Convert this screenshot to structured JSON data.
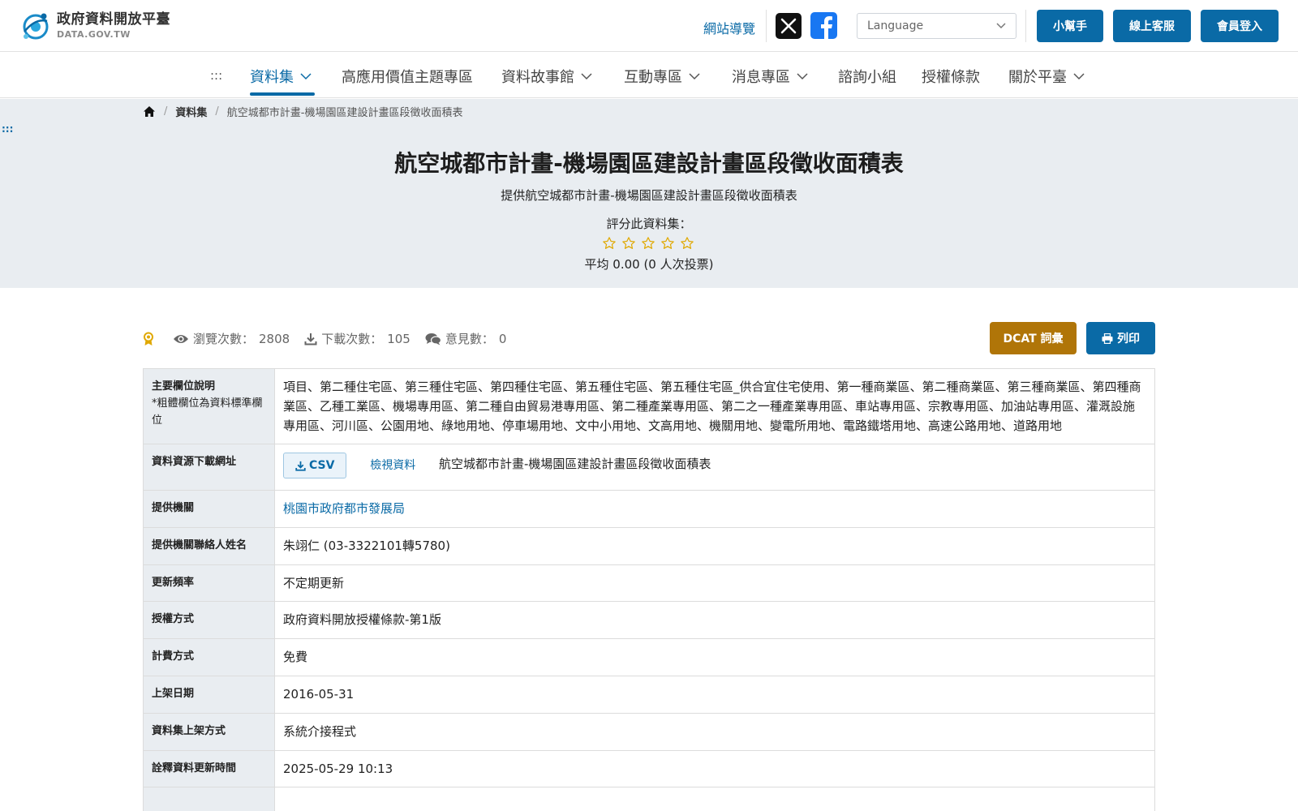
{
  "header": {
    "logo_title": "政府資料開放平臺",
    "logo_sub": "DATA.GOV.TW",
    "site_nav": "網站導覽",
    "language_placeholder": "Language",
    "helper_btn": "小幫手",
    "service_btn": "線上客服",
    "login_btn": "會員登入"
  },
  "nav": {
    "dots": ":::",
    "items": [
      {
        "label": "資料集"
      },
      {
        "label": "高應用價值主題專區"
      },
      {
        "label": "資料故事館"
      },
      {
        "label": "互動專區"
      },
      {
        "label": "消息專區"
      },
      {
        "label": "諮詢小組"
      },
      {
        "label": "授權條款"
      },
      {
        "label": "關於平臺"
      }
    ]
  },
  "breadcrumb": {
    "sep": "/",
    "items": [
      "資料集",
      "航空城都市計畫-機場園區建設計畫區段徵收面積表"
    ]
  },
  "side_dots": ":::",
  "hero": {
    "title": "航空城都市計畫-機場園區建設計畫區段徵收面積表",
    "description": "提供航空城都市計畫-機場園區建設計畫區段徵收面積表",
    "rate_label": "評分此資料集：",
    "rating": 0,
    "average": "平均 0.00 (0 人次投票)"
  },
  "stats": {
    "views_label": "瀏覽次數：",
    "views": "2808",
    "downloads_label": "下載次數：",
    "downloads": "105",
    "comments_label": "意見數：",
    "comments": "0"
  },
  "buttons": {
    "dcat": "DCAT 詞彙",
    "print": "列印"
  },
  "meta": {
    "fields_key": "主要欄位說明",
    "fields_note": "*粗體欄位為資料標準欄位",
    "fields_val": "項目、第二種住宅區、第三種住宅區、第四種住宅區、第五種住宅區、第五種住宅區_供合宜住宅使用、第一種商業區、第二種商業區、第三種商業區、第四種商業區、乙種工業區、機場專用區、第二種自由貿易港專用區、第二種產業專用區、第二之一種產業專用區、車站專用區、宗教專用區、加油站專用區、灌溉設施專用區、河川區、公園用地、綠地用地、停車場用地、文中小用地、文高用地、機關用地、變電所用地、電路鐵塔用地、高速公路用地、道路用地",
    "download_key": "資料資源下載網址",
    "csv_label": "CSV",
    "view_label": "檢視資料",
    "resource_name": "航空城都市計畫-機場園區建設計畫區段徵收面積表",
    "agency_key": "提供機關",
    "agency_val": "桃園市政府都市發展局",
    "contact_key": "提供機關聯絡人姓名",
    "contact_val": "朱翊仁 (03-3322101轉5780)",
    "freq_key": "更新頻率",
    "freq_val": "不定期更新",
    "license_key": "授權方式",
    "license_val": "政府資料開放授權條款-第1版",
    "fee_key": "計費方式",
    "fee_val": "免費",
    "date_key": "上架日期",
    "date_val": "2016-05-31",
    "method_key": "資料集上架方式",
    "method_val": "系統介接程式",
    "updated_key": "詮釋資料更新時間",
    "updated_val": "2025-05-29 10:13"
  },
  "colors": {
    "primary": "#0a6aa6",
    "dcat": "#b07508",
    "hero_bg": "#e9edf1",
    "star": "#e0a800"
  }
}
